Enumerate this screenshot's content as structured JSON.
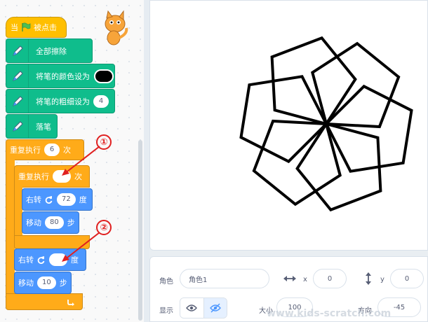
{
  "code": {
    "hat": {
      "prefix": "当",
      "suffix": "被点击"
    },
    "blocks": {
      "clear": "全部擦除",
      "set_color": "将笔的颜色设为",
      "set_size": "将笔的粗细设为",
      "set_size_value": "4",
      "pen_down": "落笔",
      "repeat_outer": "重复执行",
      "repeat_outer_value": "6",
      "times": "次",
      "repeat_inner": "重复执行",
      "turn_label": "右转",
      "turn_inner_value": "72",
      "degree": "度",
      "move_label": "移动",
      "move_inner_value": "80",
      "steps": "步",
      "move_outer_value": "10"
    },
    "colors": {
      "pen_color": "#000000"
    }
  },
  "annotations": {
    "one": "①",
    "two": "②"
  },
  "sprite_info": {
    "sprite_label": "角色",
    "sprite_name": "角色1",
    "x_label": "x",
    "x_value": "0",
    "y_label": "y",
    "y_value": "0",
    "show_label": "显示",
    "size_label": "大小",
    "size_value": "100",
    "direction_label": "方向",
    "direction_value": "-45"
  },
  "watermark": "www.kids-scratch.com"
}
